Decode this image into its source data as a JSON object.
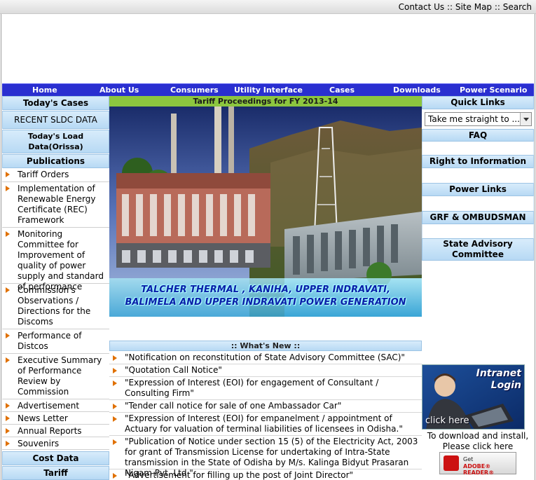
{
  "top_links": {
    "contact": "Contact Us",
    "sep1": " :: ",
    "sitemap": "Site Map",
    "sep2": " :: ",
    "search": "Search"
  },
  "nav": {
    "items": [
      "Home",
      "About Us",
      "Consumers",
      "Utility Interface",
      "Cases",
      "Downloads",
      "Power Scenario"
    ]
  },
  "left": {
    "todays_cases": "Today's Cases",
    "recent_sldc": "RECENT SLDC DATA",
    "todays_load": "Today's Load Data(Orissa)",
    "publications": "Publications",
    "pub_items": [
      "Tariff Orders",
      "Implementation of Renewable Energy Certificate (REC) Framework",
      "Monitoring Committee for Improvement of quality of power supply and standard of performance",
      "Commission's Observations / Directions for the Discoms",
      "Performance of Distcos",
      "Executive Summary of Performance Review by Commission",
      "Advertisement",
      "News Letter",
      "Annual Reports",
      "Souvenirs"
    ],
    "cost_data": "Cost Data",
    "tariff": "Tariff"
  },
  "middle": {
    "title": "Tariff Proceedings for FY 2013-14",
    "banner_line1": "TALCHER  THERMAL , KANIHA, UPPER INDRAVATI,",
    "banner_line2": "BALIMELA AND UPPER INDRAVATI POWER GENERATION",
    "whats_new": ":: What's New ::",
    "news": [
      "\"Notification on reconstitution of State Advisory Committee (SAC)\"",
      "\"Quotation Call Notice\"",
      "\"Expression of Interest (EOI) for engagement of Consultant / Consulting Firm\"",
      "\"Tender call notice for sale of one Ambassador Car\"",
      "\"Expression of Interest (EOI) for empanelment / appointment of Actuary for valuation of terminal liabilities of licensees in Odisha.\"",
      "\"Publication of Notice under section 15 (5) of the Electricity Act, 2003 for grant of Transmission License for undertaking of Intra-State transmission in the State of Odisha by M/s. Kalinga Bidyut Prasaran Nigam Pvt. Ltd.\"",
      "\"Advertisement for filling up the post of Joint Director\""
    ]
  },
  "right": {
    "quick_links": "Quick Links",
    "select_value": "Take me straight to ...",
    "faq": "FAQ",
    "rti": "Right to Information",
    "power_links": "Power Links",
    "grf": "GRF & OMBUDSMAN",
    "sac": "State Advisory Committee",
    "intranet_title1": "Intranet",
    "intranet_title2": "Login",
    "click_here": "click here",
    "download_text": "To download and install, Please click here",
    "adobe_get": "Get",
    "adobe_reader": "ADOBE® READER®"
  },
  "colors": {
    "nav_bg": "#2a2fd0",
    "header_bg": "#b7d9f4",
    "title_bar": "#8cc63f",
    "bullet": "#e07000"
  }
}
